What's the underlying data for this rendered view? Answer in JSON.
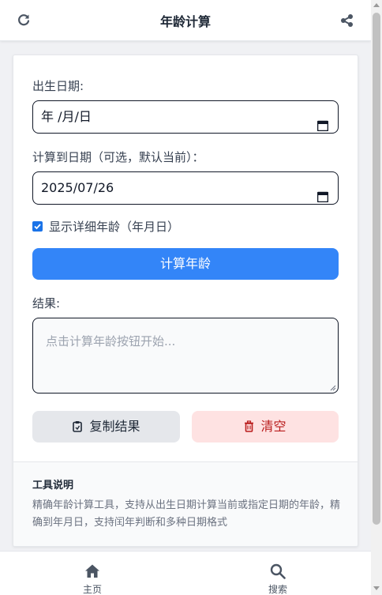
{
  "header": {
    "title": "年龄计算",
    "left_icon": "refresh-icon",
    "right_icon": "share-icon"
  },
  "form": {
    "birth_label": "出生日期:",
    "birth_value": "年 /月/日",
    "target_label": "计算到日期（可选，默认当前）：",
    "target_value": "2025/07/26",
    "detail_checkbox_label": "显示详细年龄（年月日）",
    "detail_checked": true,
    "calculate_button": "计算年龄",
    "result_label": "结果:",
    "result_placeholder": "点击计算年龄按钮开始...",
    "copy_button": "复制结果",
    "clear_button": "清空"
  },
  "info": {
    "title": "工具说明",
    "description": "精确年龄计算工具，支持从出生日期计算当前或指定日期的年龄，精确到年月日，支持闰年判断和多种日期格式"
  },
  "nav": {
    "items": [
      {
        "label": "主页",
        "icon": "home-icon"
      },
      {
        "label": "搜索",
        "icon": "search-icon"
      }
    ]
  },
  "colors": {
    "primary": "#3385f8",
    "danger_bg": "#fee2e2",
    "danger_text": "#b91c1c",
    "neutral_bg": "#e5e7eb"
  }
}
